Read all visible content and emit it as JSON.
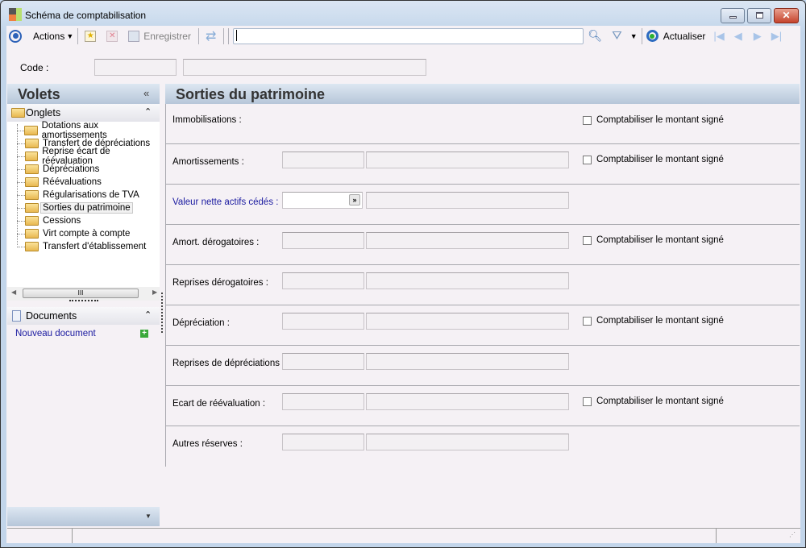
{
  "window": {
    "title": "Schéma de comptabilisation"
  },
  "toolbar": {
    "actions": "Actions",
    "save": "Enregistrer",
    "search_value": "",
    "refresh": "Actualiser"
  },
  "code": {
    "label": "Code :",
    "value1": "",
    "value2": ""
  },
  "sidebar": {
    "title": "Volets",
    "onglets": "Onglets",
    "items": [
      "Dotations aux amortissements",
      "Transfert de dépréciations",
      "Reprise écart de réévaluation",
      "Dépréciations",
      "Réévaluations",
      "Régularisations de TVA",
      "Sorties du patrimoine",
      "Cessions",
      "Virt compte à compte",
      "Transfert d'établissement"
    ],
    "selected": "Sorties du patrimoine",
    "documents": "Documents",
    "new_doc": "Nouveau document",
    "scroll_grip": "III"
  },
  "main": {
    "title": "Sorties du patrimoine",
    "checkbox_label": "Comptabiliser le montant signé",
    "rows": [
      {
        "label": "Immobilisations :",
        "fields": false,
        "check": true
      },
      {
        "label": "Amortissements :",
        "fields": true,
        "check": true
      },
      {
        "label": "Valeur nette actifs cédés :",
        "fields": true,
        "combo": true,
        "check": false,
        "highlight": true
      },
      {
        "label": "Amort. dérogatoires :",
        "fields": true,
        "check": true
      },
      {
        "label": "Reprises dérogatoires :",
        "fields": true,
        "check": false
      },
      {
        "label": "Dépréciation :",
        "fields": true,
        "check": true
      },
      {
        "label": "Reprises de dépréciations :",
        "fields": true,
        "check": false
      },
      {
        "label": "Ecart de réévaluation :",
        "fields": true,
        "check": true
      },
      {
        "label": "Autres réserves :",
        "fields": true,
        "check": false
      }
    ]
  },
  "colors": {
    "link": "#1a1aa0",
    "background": "#f5f1f5"
  }
}
